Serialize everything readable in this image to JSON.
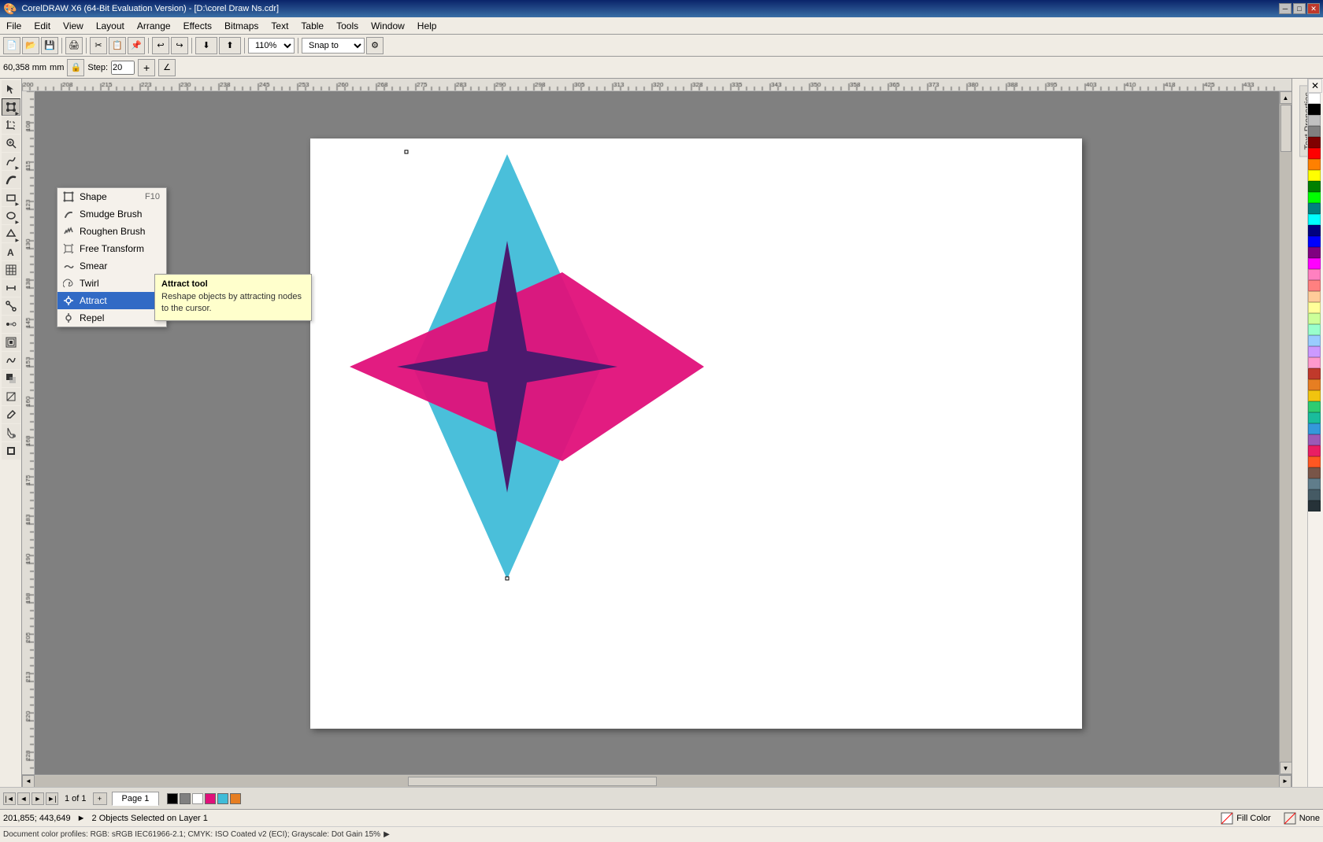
{
  "titleBar": {
    "title": "CorelDRAW X6 (64-Bit Evaluation Version) - [D:\\corel Draw Ns.cdr]",
    "minBtn": "─",
    "maxBtn": "□",
    "closeBtn": "✕"
  },
  "menuBar": {
    "items": [
      "File",
      "Edit",
      "View",
      "Layout",
      "Arrange",
      "Effects",
      "Bitmaps",
      "Text",
      "Table",
      "Tools",
      "Window",
      "Help"
    ]
  },
  "toolbar": {
    "zoomLevel": "110%",
    "snapTo": "Snap to"
  },
  "propBar": {
    "coordinates": "60,358 mm",
    "stepValue": "20"
  },
  "contextMenu": {
    "items": [
      {
        "label": "Shape",
        "shortcut": "F10",
        "icon": "shape"
      },
      {
        "label": "Smudge Brush",
        "shortcut": "",
        "icon": "smudge"
      },
      {
        "label": "Roughen Brush",
        "shortcut": "",
        "icon": "roughen"
      },
      {
        "label": "Free Transform",
        "shortcut": "",
        "icon": "transform"
      },
      {
        "label": "Smear",
        "shortcut": "",
        "icon": "smear"
      },
      {
        "label": "Twirl",
        "shortcut": "",
        "icon": "twirl"
      },
      {
        "label": "Attract",
        "shortcut": "",
        "icon": "attract",
        "active": true
      },
      {
        "label": "Repel",
        "shortcut": "",
        "icon": "repel"
      }
    ]
  },
  "tooltip": {
    "title": "Attract tool",
    "body": "Reshape objects by attracting nodes to the cursor."
  },
  "statusBar": {
    "coordinates": "201,855; 443,649",
    "selection": "2 Objects Selected on Layer 1",
    "fillLabel": "Fill Color",
    "noFill": "None"
  },
  "pageNav": {
    "current": "1 of 1",
    "pageName": "Page 1"
  },
  "colors": {
    "cyan": "#40bcd8",
    "magenta": "#e0107a",
    "purple": "#4b1a6e"
  },
  "palette": [
    "#ffffff",
    "#000000",
    "#808080",
    "#c0c0c0",
    "#800000",
    "#ff0000",
    "#ff8000",
    "#ffff00",
    "#008000",
    "#00ff00",
    "#008080",
    "#00ffff",
    "#000080",
    "#0000ff",
    "#800080",
    "#ff00ff",
    "#ff80c0",
    "#ff8080",
    "#ffcc99",
    "#ffff99",
    "#ccff99",
    "#99ffcc",
    "#99ccff",
    "#cc99ff",
    "#ff99cc",
    "#c0392b",
    "#e67e22",
    "#f1c40f",
    "#2ecc71",
    "#1abc9c",
    "#3498db",
    "#9b59b6",
    "#e91e63",
    "#ff5722",
    "#795548",
    "#607d8b",
    "#455a64",
    "#263238"
  ]
}
